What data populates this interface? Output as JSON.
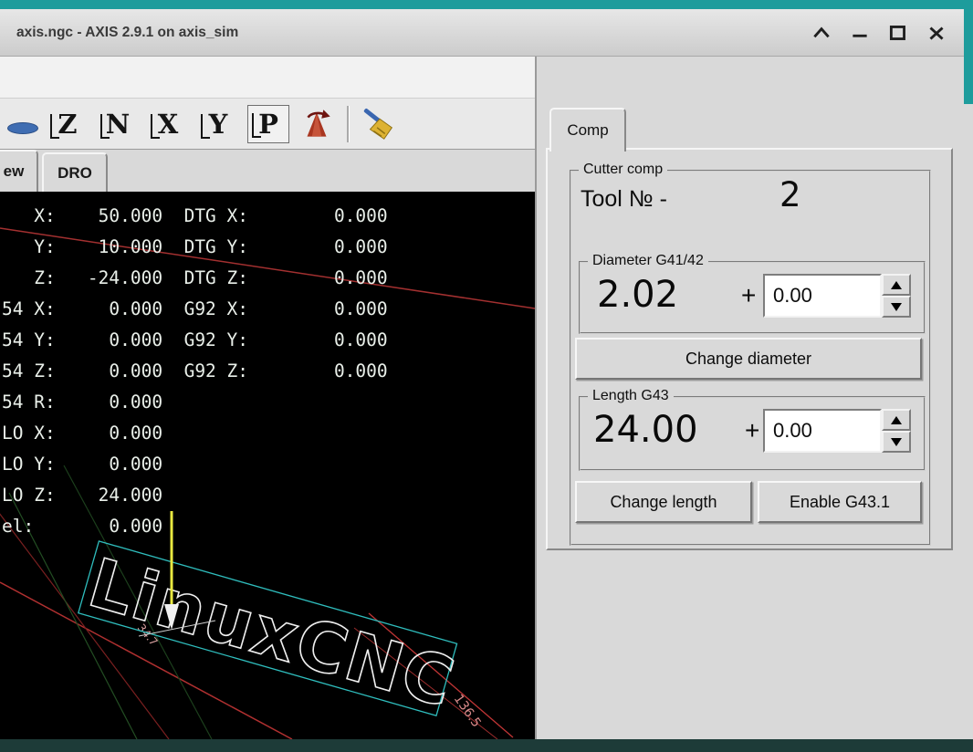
{
  "window": {
    "title": "axis.ngc - AXIS 2.9.1 on axis_sim",
    "control_icons": [
      "rollup-icon",
      "minimize-icon",
      "maximize-icon",
      "close-icon"
    ]
  },
  "toolbar": {
    "views": [
      {
        "label": "Z",
        "active": false
      },
      {
        "label": "N",
        "active": false
      },
      {
        "label": "X",
        "active": false
      },
      {
        "label": "Y",
        "active": false
      },
      {
        "label": "P",
        "active": true
      }
    ],
    "icons": [
      "zoom-icon",
      "rotate-cone-icon",
      "clear-plot-broom-icon"
    ]
  },
  "left_tabs": [
    {
      "label": "ew"
    },
    {
      "label": "DRO"
    }
  ],
  "dro": {
    "lines": [
      "   X:    50.000  DTG X:        0.000",
      "   Y:    10.000  DTG Y:        0.000",
      "   Z:   -24.000  DTG Z:        0.000",
      "54 X:     0.000  G92 X:        0.000",
      "54 Y:     0.000  G92 Y:        0.000",
      "54 Z:     0.000  G92 Z:        0.000",
      "54 R:     0.000",
      "LO X:     0.000",
      "LO Y:     0.000",
      "LO Z:    24.000",
      "el:       0.000"
    ]
  },
  "scene": {
    "logo": "LinuxCNC",
    "dim_main": "136.5",
    "dim_small": "34.7"
  },
  "comp": {
    "tab_label": "Comp",
    "group_title": "Cutter comp",
    "tool_label": "Tool № -",
    "tool_value": "2",
    "diameter": {
      "title": "Diameter G41/42",
      "value": "2.02",
      "plus": "+",
      "offset": "0.00",
      "button": "Change diameter"
    },
    "length": {
      "title": "Length G43",
      "value": "24.00",
      "plus": "+",
      "offset": "0.00",
      "button_change": "Change length",
      "button_enable": "Enable G43.1"
    }
  },
  "colors": {
    "frame_teal": "#1e9c9c",
    "frame_bottom": "#1d3b38",
    "panel_gray": "#d9d9d9",
    "canvas_bg": "#000000",
    "dro_text": "#e9efe9",
    "path_red": "#b03030",
    "path_teal": "#2fbdbd"
  }
}
